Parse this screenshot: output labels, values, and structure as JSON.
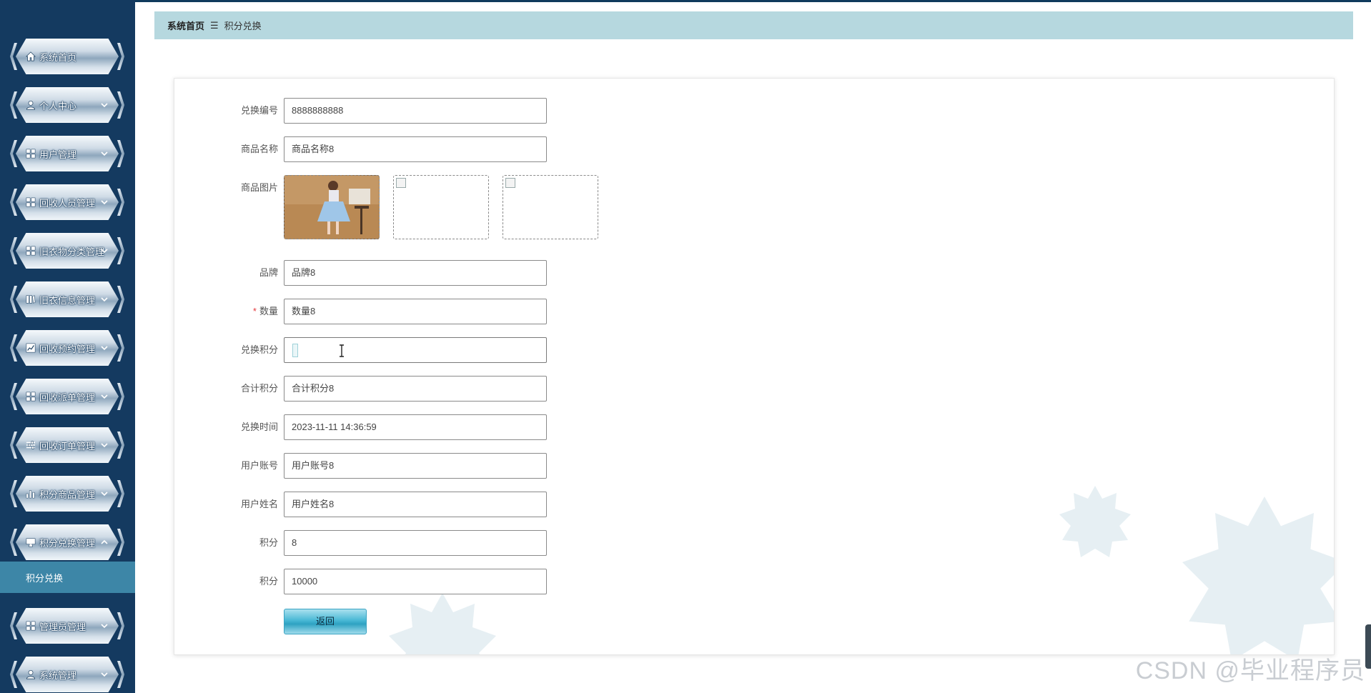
{
  "sidebar": {
    "items": [
      {
        "label": "系统首页",
        "icon": "home-icon",
        "has_chevron": false
      },
      {
        "label": "个人中心",
        "icon": "user-icon",
        "has_chevron": true
      },
      {
        "label": "用户管理",
        "icon": "grid-icon",
        "has_chevron": true
      },
      {
        "label": "回收人员管理",
        "icon": "grid-icon",
        "has_chevron": true
      },
      {
        "label": "旧衣物分类管理",
        "icon": "grid-icon",
        "has_chevron": true
      },
      {
        "label": "旧衣信息管理",
        "icon": "book-icon",
        "has_chevron": true
      },
      {
        "label": "回收预约管理",
        "icon": "chart-line-icon",
        "has_chevron": true
      },
      {
        "label": "回收派单管理",
        "icon": "grid-icon",
        "has_chevron": true
      },
      {
        "label": "回收订单管理",
        "icon": "sliders-icon",
        "has_chevron": true
      },
      {
        "label": "积分商品管理",
        "icon": "bar-chart-icon",
        "has_chevron": true
      },
      {
        "label": "积分兑换管理",
        "icon": "monitor-icon",
        "has_chevron": true,
        "expanded": true
      },
      {
        "label": "管理员管理",
        "icon": "grid-icon",
        "has_chevron": true
      },
      {
        "label": "系统管理",
        "icon": "user-icon",
        "has_chevron": true
      }
    ],
    "sub_item": "积分兑换"
  },
  "breadcrumb": {
    "home": "系统首页",
    "separator": "☰",
    "current": "积分兑换"
  },
  "form": {
    "fields": [
      {
        "label": "兑换编号",
        "value": "8888888888"
      },
      {
        "label": "商品名称",
        "value": "商品名称8"
      },
      {
        "label": "品牌",
        "value": "品牌8"
      },
      {
        "label": "数量",
        "value": "数量8",
        "required": true
      },
      {
        "label": "兑换积分",
        "value": ""
      },
      {
        "label": "合计积分",
        "value": "合计积分8"
      },
      {
        "label": "兑换时间",
        "value": "2023-11-11 14:36:59"
      },
      {
        "label": "用户账号",
        "value": "用户账号8"
      },
      {
        "label": "用户姓名",
        "value": "用户姓名8"
      },
      {
        "label": "积分",
        "value": "8"
      },
      {
        "label": "积分",
        "value": "10000"
      }
    ],
    "image_label": "商品图片",
    "required_mark": "*",
    "back_button": "返回"
  },
  "watermark": "CSDN @毕业程序员",
  "colors": {
    "sidebar_bg": "#143a60",
    "breadcrumb_bg": "#b6d8df",
    "submenu_active": "#3d86a7",
    "button_accent": "#2ea2c2"
  }
}
